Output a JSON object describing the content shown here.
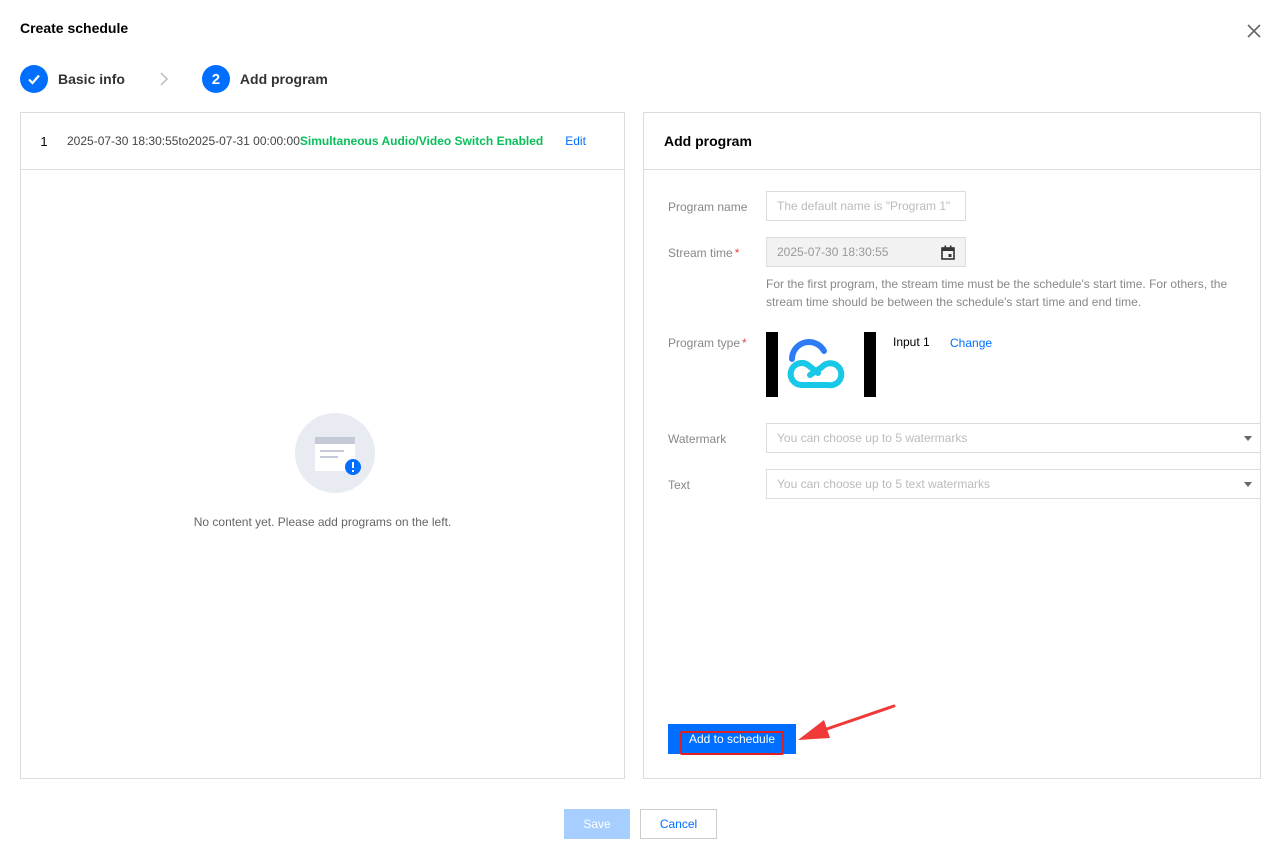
{
  "dialog": {
    "title": "Create schedule"
  },
  "steps": [
    {
      "label": "Basic info",
      "state": "done"
    },
    {
      "number": "2",
      "label": "Add program",
      "state": "active"
    }
  ],
  "schedule": {
    "row": {
      "index": "1",
      "range": "2025-07-30 18:30:55to2025-07-31 00:00:00",
      "status": "Simultaneous Audio/Video Switch Enabled",
      "edit_label": "Edit"
    },
    "empty_text": "No content yet. Please add programs on the left."
  },
  "form": {
    "header": "Add program",
    "program_name": {
      "label": "Program name",
      "placeholder": "The default name is \"Program 1\""
    },
    "stream_time": {
      "label": "Stream time",
      "required": "*",
      "value": "2025-07-30 18:30:55"
    },
    "hint": "For the first program, the stream time must be the schedule's start time. For others, the stream time should be between the schedule's start time and end time.",
    "program_type": {
      "label": "Program type",
      "required": "*",
      "input_name": "Input 1",
      "change_label": "Change"
    },
    "watermark": {
      "label": "Watermark",
      "placeholder": "You can choose up to 5 watermarks"
    },
    "text": {
      "label": "Text",
      "placeholder": "You can choose up to 5 text watermarks"
    },
    "add_button": "Add to schedule"
  },
  "footer": {
    "save_label": "Save",
    "cancel_label": "Cancel"
  },
  "colors": {
    "primary": "#006eff",
    "success": "#0abf5b",
    "annotation": "#e02020"
  }
}
